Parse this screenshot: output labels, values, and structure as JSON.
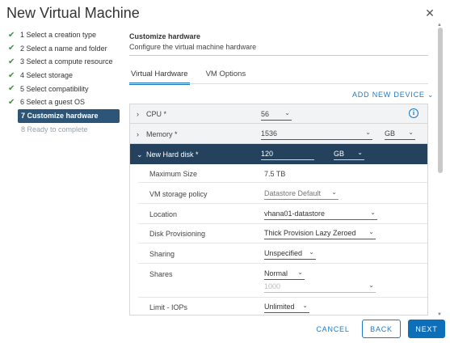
{
  "window": {
    "title": "New Virtual Machine",
    "close_icon": "close-icon"
  },
  "steps": [
    {
      "label": "1 Select a creation type",
      "state": "done"
    },
    {
      "label": "2 Select a name and folder",
      "state": "done"
    },
    {
      "label": "3 Select a compute resource",
      "state": "done"
    },
    {
      "label": "4 Select storage",
      "state": "done"
    },
    {
      "label": "5 Select compatibility",
      "state": "done"
    },
    {
      "label": "6 Select a guest OS",
      "state": "done"
    },
    {
      "label": "7 Customize hardware",
      "state": "active"
    },
    {
      "label": "8 Ready to complete",
      "state": "inactive"
    }
  ],
  "header": {
    "title": "Customize hardware",
    "subtitle": "Configure the virtual machine hardware"
  },
  "tabs": [
    {
      "label": "Virtual Hardware",
      "active": true
    },
    {
      "label": "VM Options",
      "active": false
    }
  ],
  "add_device": "ADD NEW DEVICE",
  "hardware": {
    "cpu": {
      "label": "CPU *",
      "value": "56"
    },
    "memory": {
      "label": "Memory *",
      "value": "1536",
      "unit": "GB"
    },
    "disk": {
      "label": "New Hard disk *",
      "value": "120",
      "unit": "GB",
      "max_size_label": "Maximum Size",
      "max_size_value": "7.5 TB",
      "storage_policy_label": "VM storage policy",
      "storage_policy_value": "Datastore Default",
      "location_label": "Location",
      "location_value": "vhana01-datastore",
      "provisioning_label": "Disk Provisioning",
      "provisioning_value": "Thick Provision Lazy Zeroed",
      "sharing_label": "Sharing",
      "sharing_value": "Unspecified",
      "shares_label": "Shares",
      "shares_value": "Normal",
      "shares_number": "1000",
      "limit_label": "Limit - IOPs",
      "limit_value": "Unlimited"
    }
  },
  "buttons": {
    "cancel": "CANCEL",
    "back": "BACK",
    "next": "NEXT"
  },
  "colors": {
    "accent": "#1a7ac7",
    "active_step": "#2c5577",
    "dark_row": "#24425e",
    "check": "#3f8f3f"
  }
}
